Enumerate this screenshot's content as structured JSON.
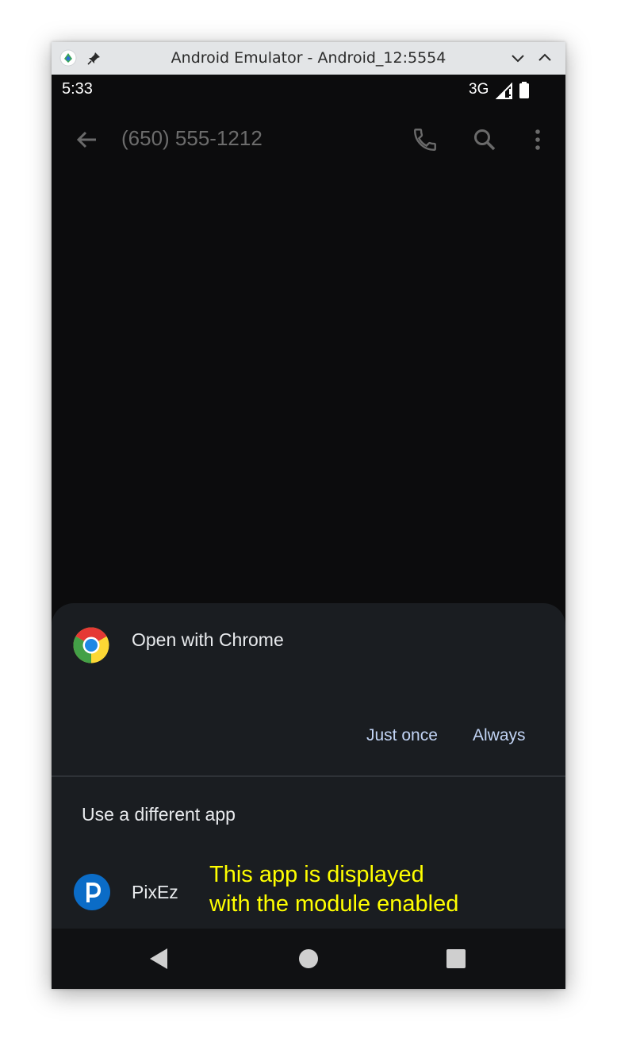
{
  "window": {
    "title": "Android Emulator - Android_12:5554"
  },
  "status_bar": {
    "time": "5:33",
    "network": "3G",
    "icons": [
      "signal-icon",
      "battery-icon"
    ]
  },
  "app_bar": {
    "title": "(650) 555-1212",
    "icons": [
      "back-arrow-icon",
      "phone-icon",
      "search-icon",
      "more-vert-icon"
    ]
  },
  "sheet": {
    "open_with": "Open with Chrome",
    "just_once": "Just once",
    "always": "Always",
    "different_app": "Use a different app",
    "apps": [
      {
        "label": "PixEz",
        "icon": "pixez-icon"
      }
    ]
  },
  "annotation": {
    "text": "This app is displayed\nwith the module enabled"
  },
  "nav_bar": {
    "icons": [
      "back-triangle-icon",
      "home-circle-icon",
      "recents-square-icon"
    ]
  },
  "colors": {
    "screen_bg": "#0c0c0d",
    "sheet_bg": "#1a1d21",
    "button_text": "#c2d4f5",
    "annotation": "#ffff00",
    "titlebar_bg": "#e3e5e7"
  }
}
